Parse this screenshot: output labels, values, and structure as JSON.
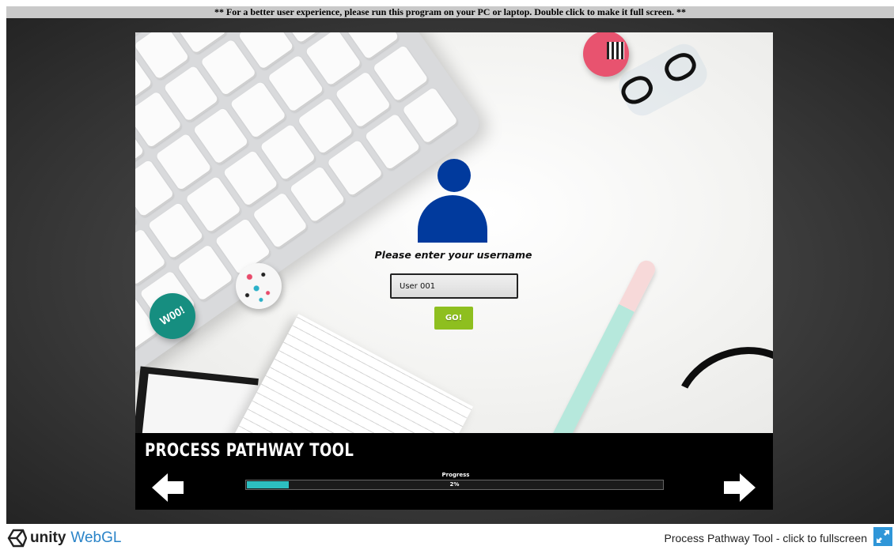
{
  "notice": "** For a better user experience, please run this program on your PC or laptop. Double click to make it full screen. **",
  "login": {
    "prompt": "Please enter your username",
    "username_value": "User 001",
    "go_label": "GO!"
  },
  "bottom_bar": {
    "title": "PROCESS PATHWAY TOOL",
    "progress_label": "Progress",
    "progress_text": "2%",
    "progress_fraction": 0.02
  },
  "footer": {
    "unity": "unity",
    "webgl": "WebGL",
    "fullscreen_text": "Process Pathway Tool - click to fullscreen"
  },
  "icons": {
    "avatar": "user-avatar-icon",
    "back": "arrow-left-icon",
    "next": "arrow-right-icon",
    "logo": "unity-logo-icon",
    "fullscreen": "fullscreen-icon"
  },
  "colors": {
    "avatar": "#013a9d",
    "go_button": "#8ebf1f",
    "progress_fill": "#2dbec0",
    "webgl": "#2a84c8",
    "fullscreen_icon_bg": "#2f96d8"
  }
}
